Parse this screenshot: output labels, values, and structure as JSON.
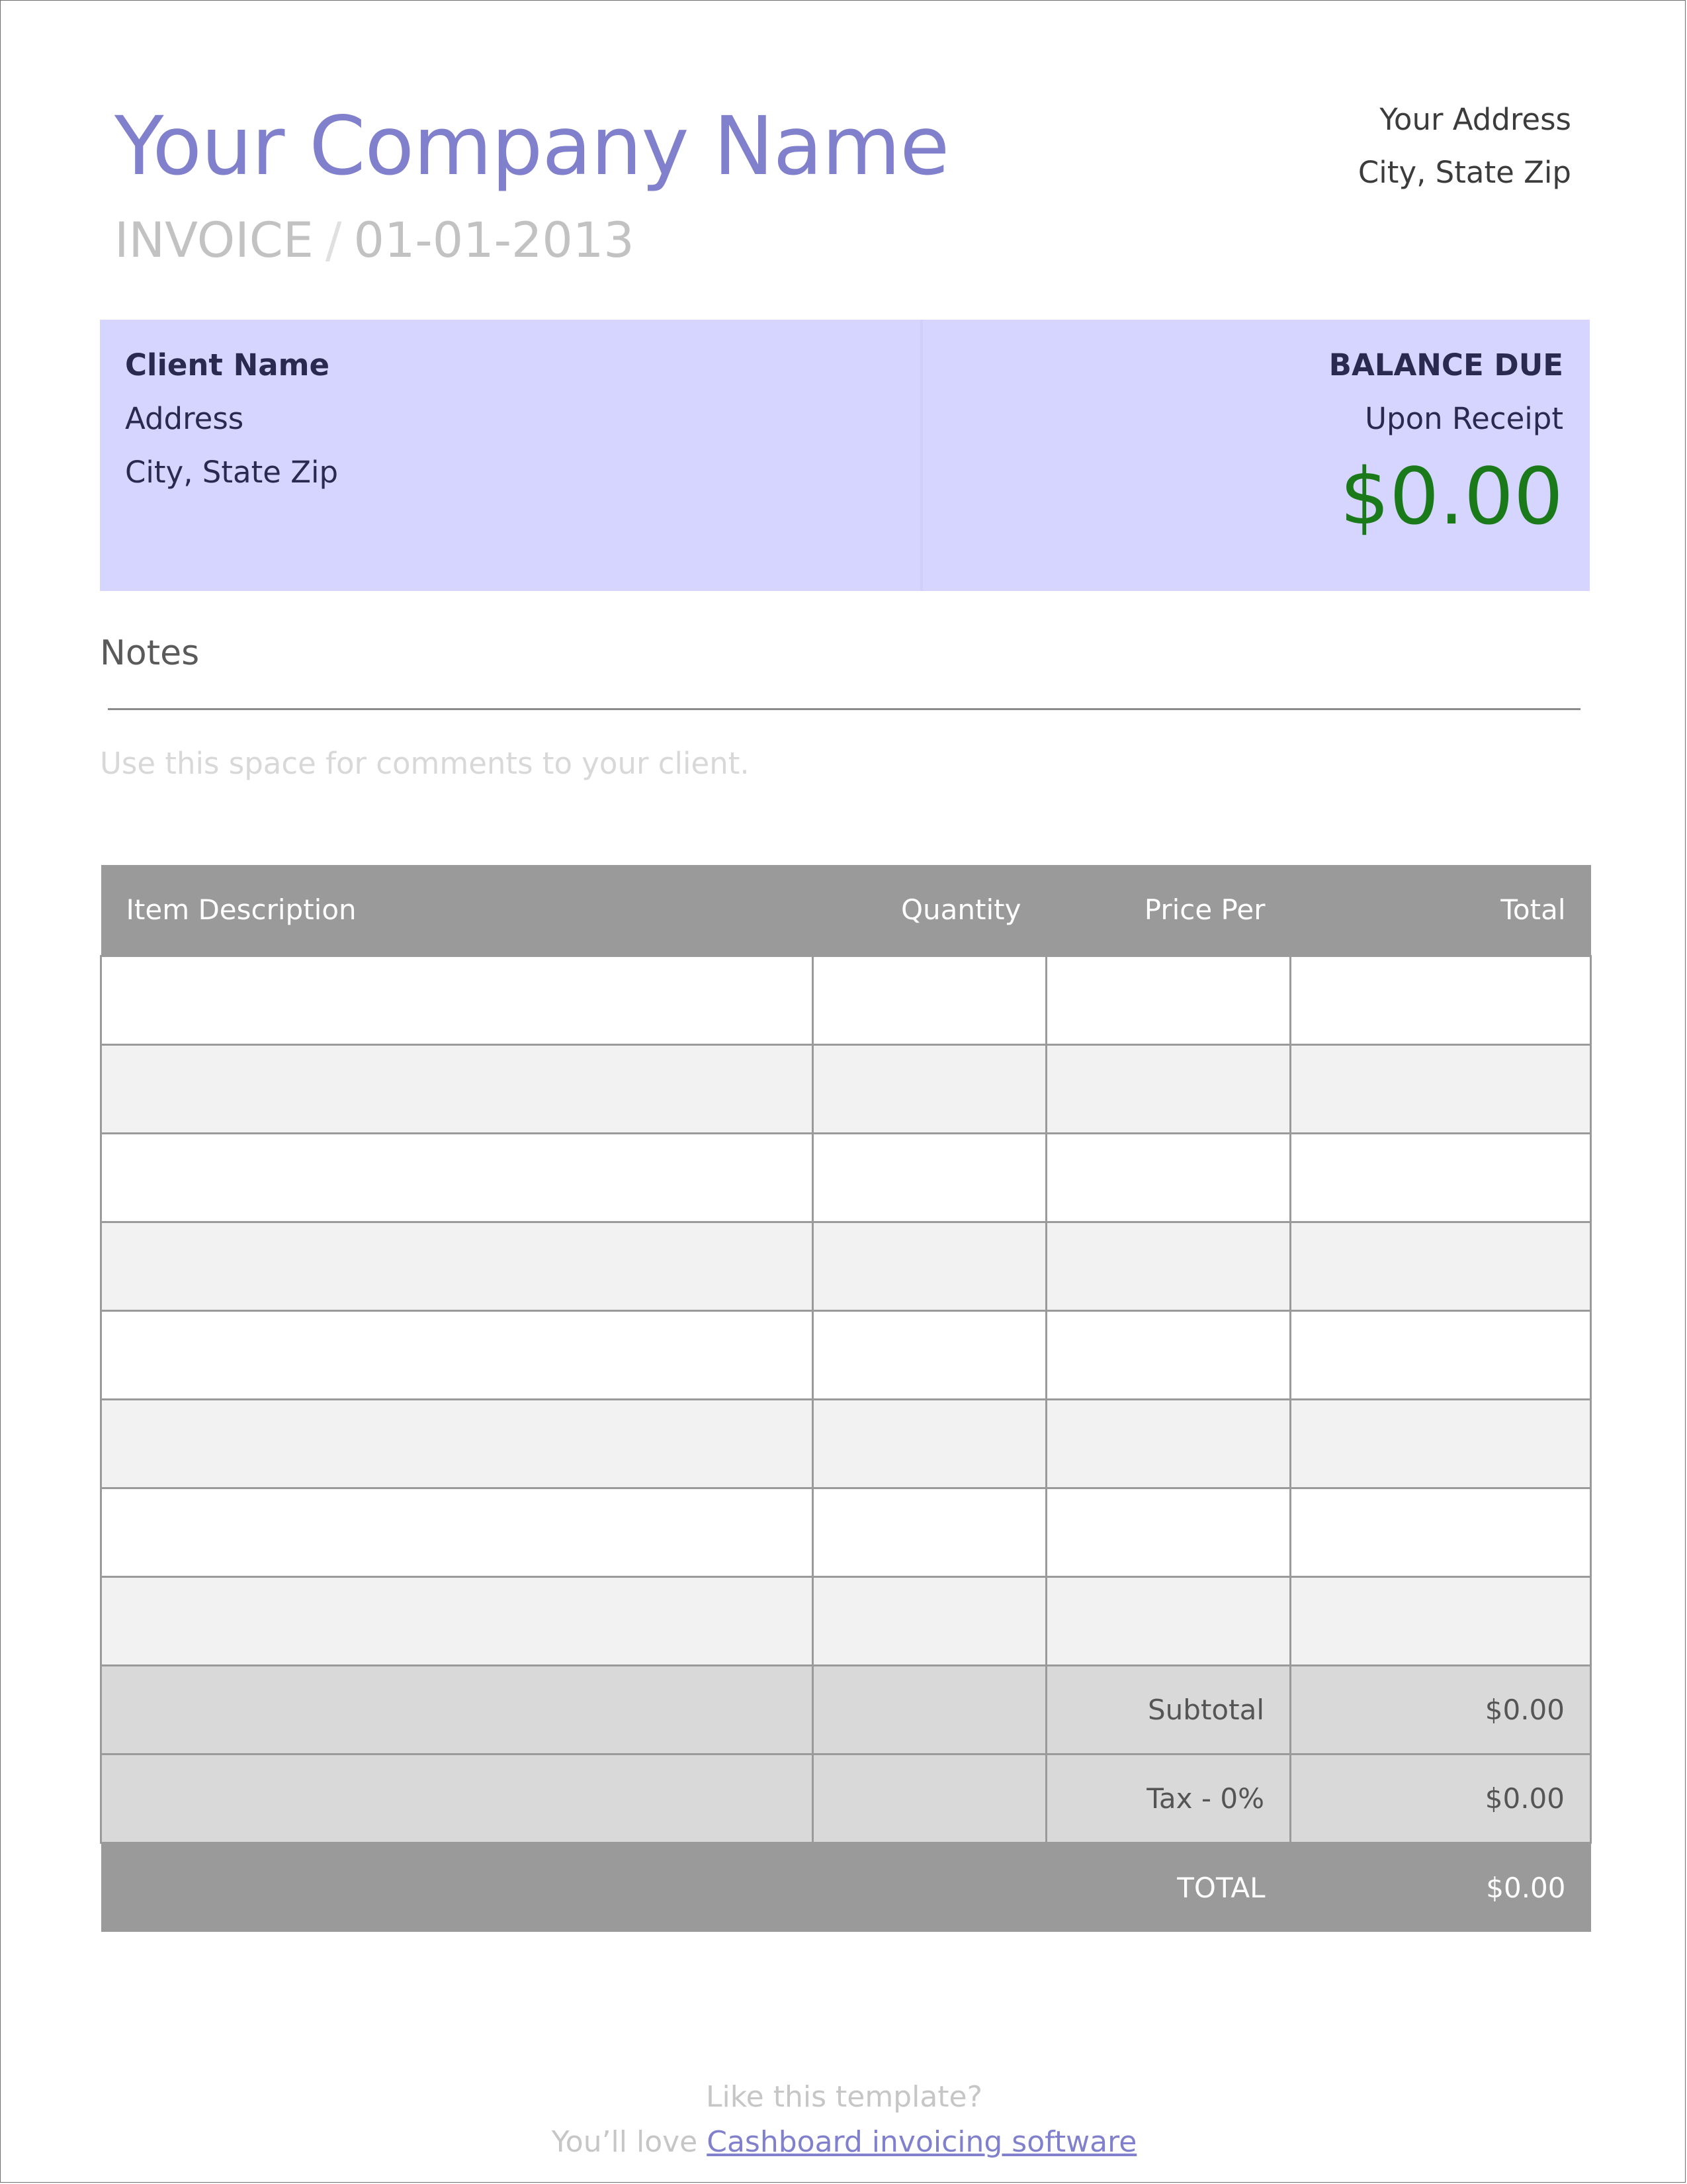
{
  "header": {
    "company_name": "Your Company Name",
    "invoice_label": "INVOICE",
    "separator": "/",
    "invoice_date": "01-01-2013",
    "address_line1": "Your Address",
    "address_line2": "City, State Zip"
  },
  "client": {
    "name": "Client Name",
    "address": "Address",
    "city": "City, State Zip"
  },
  "balance": {
    "label": "BALANCE DUE",
    "terms": "Upon Receipt",
    "amount": "$0.00"
  },
  "notes": {
    "title": "Notes",
    "placeholder": "Use this space for comments to your client."
  },
  "table": {
    "headers": {
      "description": "Item Description",
      "quantity": "Quantity",
      "price_per": "Price Per",
      "total": "Total"
    },
    "subtotal_label": "Subtotal",
    "subtotal_value": "$0.00",
    "tax_label": "Tax - 0%",
    "tax_value": "$0.00",
    "total_label": "TOTAL",
    "total_value": "$0.00"
  },
  "footer": {
    "line1": "Like this template?",
    "line2_prefix": "You’ll love",
    "link_text": "Cashboard invoicing software"
  },
  "colors": {
    "accent": "#8080cc",
    "client_box": "#d5d5ff",
    "balance_amount": "#1a7a1a",
    "table_header": "#9a9a9a"
  }
}
